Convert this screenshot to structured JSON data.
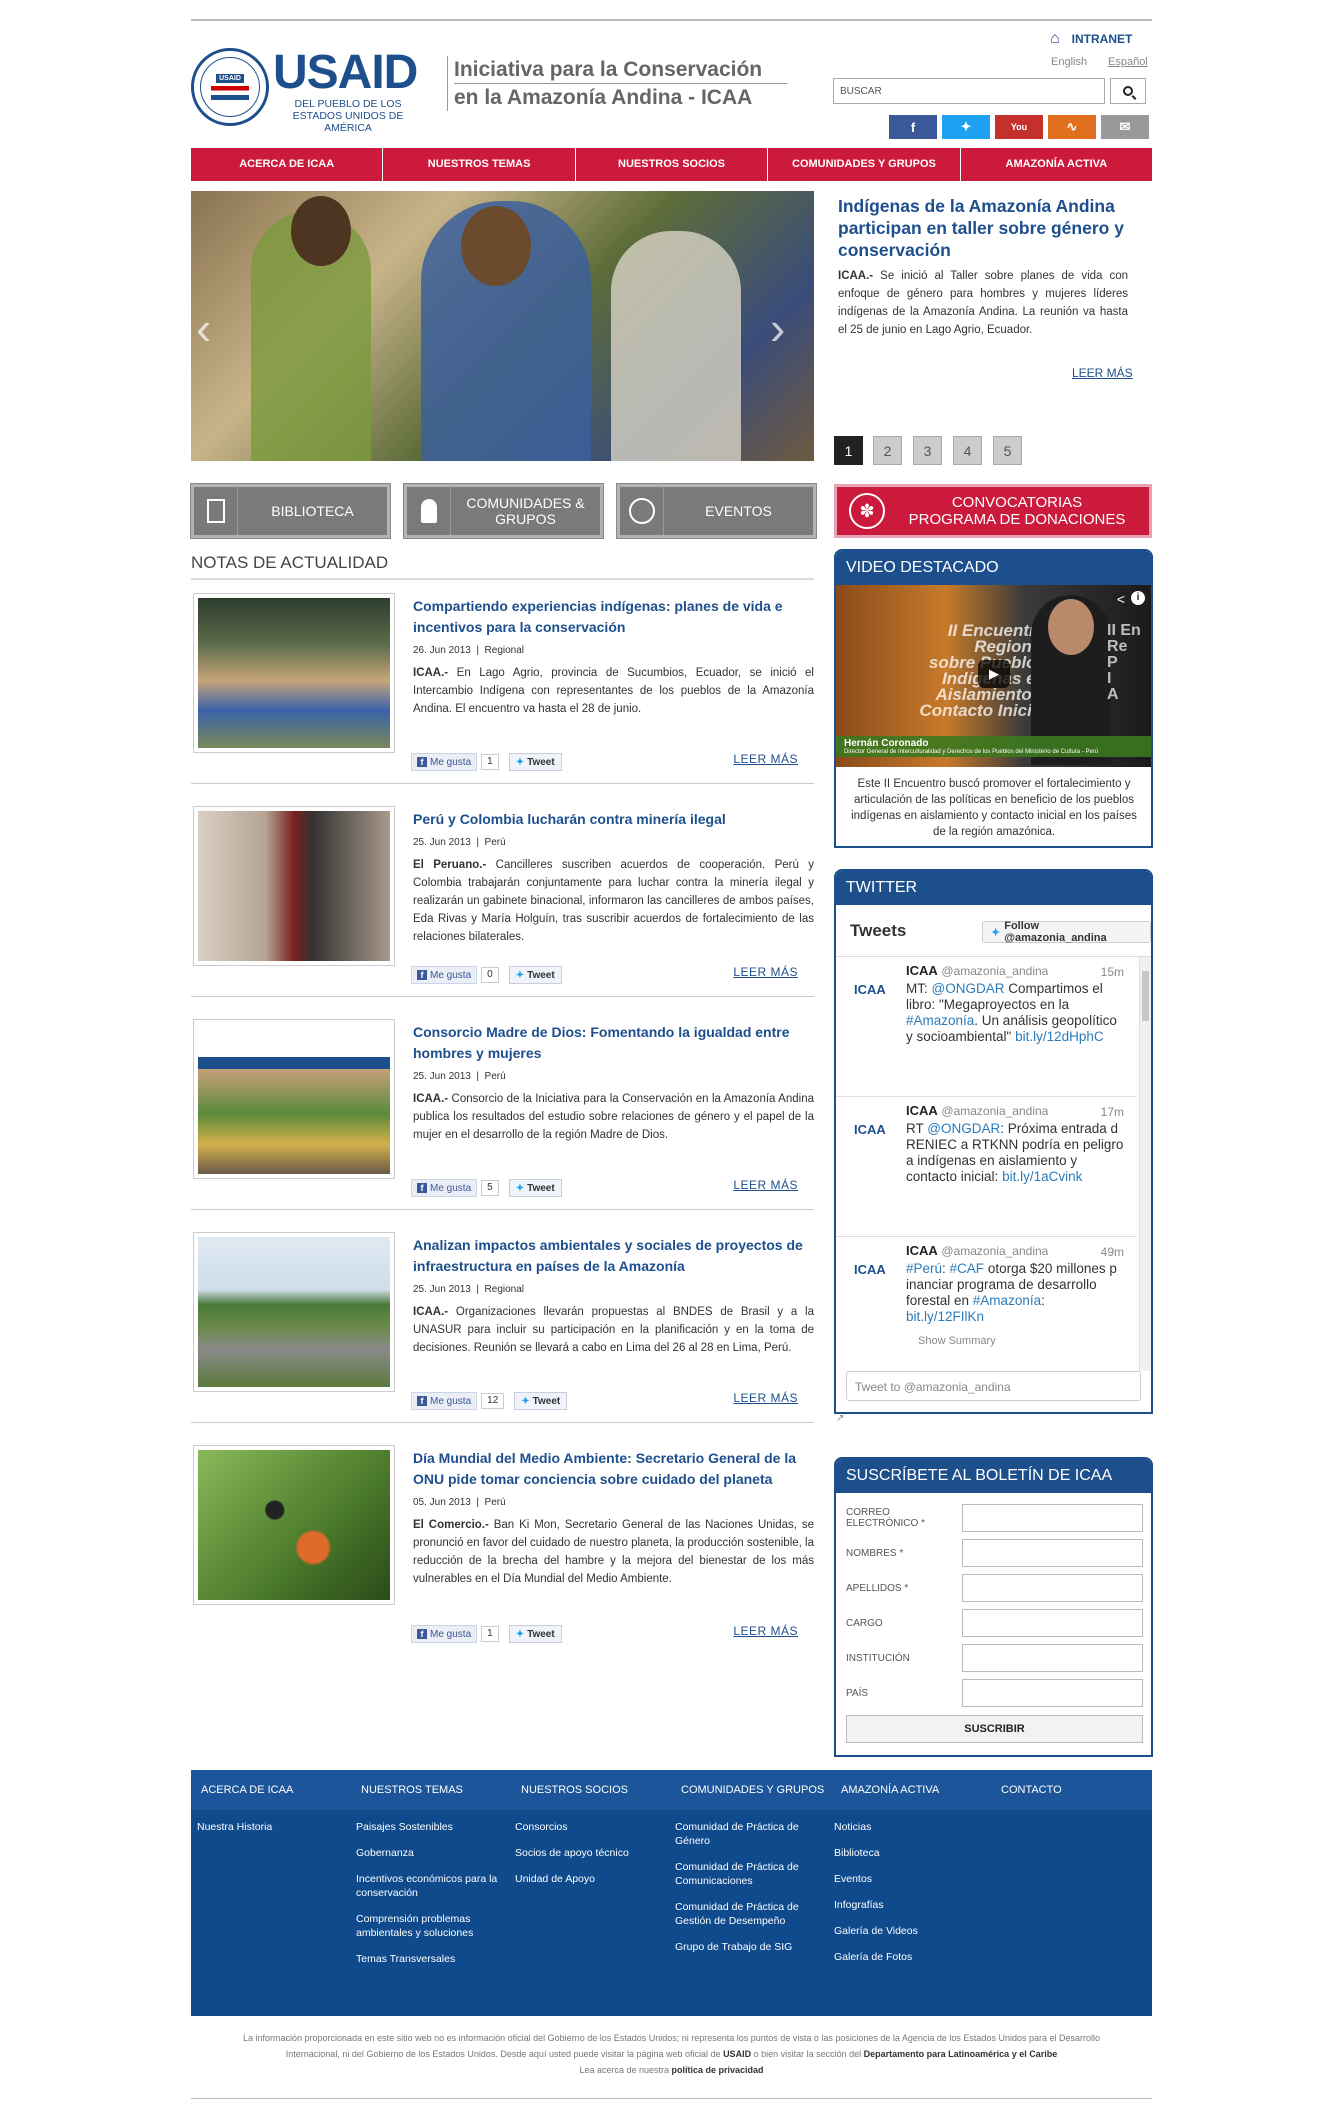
{
  "header": {
    "usaid_logo_text": "USAID",
    "usaid_sub": "DEL PUEBLO DE LOS ESTADOS UNIDOS DE AMÉRICA",
    "seal_text": "UNITED STATES AGENCY INTERNATIONAL DEVELOPMENT",
    "title_line1": "Iniciativa para la Conservación",
    "title_line2": "en la Amazonía Andina - ICAA",
    "intranet": "INTRANET",
    "lang_en": "English",
    "lang_es": "Español",
    "search_placeholder": "BUSCAR"
  },
  "nav": [
    "ACERCA DE ICAA",
    "NUESTROS TEMAS",
    "NUESTROS SOCIOS",
    "COMUNIDADES Y GRUPOS",
    "AMAZONÍA ACTIVA"
  ],
  "slider": {
    "title": "Indígenas de la Amazonía Andina participan en taller sobre género y conservación",
    "source": "ICAA.-",
    "text": " Se inició al Taller sobre planes de vida con enfoque de género para hombres y mujeres líderes indígenas de la Amazonía Andina. La reunión va hasta el 25 de junio en Lago Agrio, Ecuador.",
    "more": "LEER MÁS",
    "pages": [
      "1",
      "2",
      "3",
      "4",
      "5"
    ]
  },
  "quick_buttons": {
    "biblioteca": "BIBLIOTECA",
    "comunidades_line1": "COMUNIDADES &",
    "comunidades_line2": "GRUPOS",
    "eventos": "EVENTOS",
    "convocatorias_line1": "CONVOCATORIAS",
    "convocatorias_line2": "PROGRAMA DE DONACIONES"
  },
  "news_heading": "NOTAS DE ACTUALIDAD",
  "news": [
    {
      "title": "Compartiendo experiencias indígenas: planes de vida e incentivos para la conservación",
      "date": "26. Jun 2013",
      "region": "Regional",
      "source": "ICAA.-",
      "text": " En Lago Agrio, provincia de Sucumbios, Ecuador, se inició el Intercambio Indígena con representantes de los pueblos de la Amazonía Andina. El encuentro va hasta el 28 de junio.",
      "likes": "1",
      "like_label": "Me gusta",
      "tweet_label": "Tweet",
      "more": "LEER MÁS"
    },
    {
      "title": "Perú y Colombia lucharán contra minería ilegal",
      "date": "25. Jun 2013",
      "region": "Perú",
      "source": "El Peruano.-",
      "text": " Cancilleres suscriben acuerdos de cooperación. Perú y Colombia trabajarán conjuntamente para luchar contra la minería ilegal y realizarán un gabinete binacional, informaron las cancilleres de ambos países, Eda Rivas y María Holguín, tras suscribir acuerdos de fortalecimiento de las relaciones bilaterales.",
      "likes": "0",
      "like_label": "Me gusta",
      "tweet_label": "Tweet",
      "more": "LEER MÁS"
    },
    {
      "title": "Consorcio Madre de Dios: Fomentando la igualdad entre hombres y mujeres",
      "date": "25. Jun 2013",
      "region": "Perú",
      "source": "ICAA.-",
      "text": " Consorcio de la Iniciativa para la Conservación en la Amazonía Andina publica los resultados del estudio sobre relaciones de género y el papel de la mujer en el desarrollo de la región Madre de Dios.",
      "likes": "5",
      "like_label": "Me gusta",
      "tweet_label": "Tweet",
      "more": "LEER MÁS"
    },
    {
      "title": "Analizan impactos ambientales y sociales de proyectos de infraestructura en países de la Amazonía",
      "date": "25. Jun 2013",
      "region": "Regional",
      "source": "ICAA.-",
      "text": " Organizaciones llevarán propuestas al BNDES de Brasil y a la UNASUR para incluir su participación en la planificación y en la toma de decisiones. Reunión se llevará a cabo en Lima del 26 al 28 en Lima, Perú.",
      "likes": "12",
      "like_label": "Me gusta",
      "tweet_label": "Tweet",
      "more": "LEER MÁS"
    },
    {
      "title": "Día Mundial del Medio Ambiente: Secretario General de la ONU pide tomar conciencia sobre cuidado del planeta",
      "date": "05. Jun 2013",
      "region": "Perú",
      "source": "El Comercio.-",
      "text": " Ban Ki Mon, Secretario General de las Naciones Unidas, se pronunció en favor del cuidado de nuestro planeta, la producción sostenible, la reducción de la brecha del hambre y la mejora del bienestar de los más vulnerables en el Día Mundial del Medio Ambiente.",
      "likes": "1",
      "like_label": "Me gusta",
      "tweet_label": "Tweet",
      "more": "LEER MÁS"
    }
  ],
  "video": {
    "heading": "VIDEO DESTACADO",
    "overlay_lines": [
      "II Encuentro",
      "Regional",
      "sobre Pueblos",
      "Indígenas en",
      "Aislamiento y",
      "Contacto Inicial"
    ],
    "caption_name": "Hernán Coronado",
    "caption_role": "Director General de Interculturalidad y Derechos de los Pueblos del Ministerio de Cultura - Perú",
    "desc": "Este II Encuentro buscó promover el fortalecimiento y articulación de las políticas en beneficio de los pueblos indígenas en aislamiento y contacto inicial en los países de la región amazónica."
  },
  "twitter": {
    "heading": "TWITTER",
    "tweets_label": "Tweets",
    "follow": "Follow @amazonia_andina",
    "items": [
      {
        "logo": "ICAA",
        "name": "ICAA",
        "handle": "@amazonia_andina",
        "time": "15m",
        "pre": "MT: ",
        "l1": "@ONGDAR",
        "mid": " Compartimos el libro: \"Megaproyectos en la ",
        "l2": "#Amazonía",
        "post": ". Un análisis geopolítico y socioambiental\" ",
        "l3": "bit.ly/12dHphC"
      },
      {
        "logo": "ICAA",
        "name": "ICAA",
        "handle": "@amazonia_andina",
        "time": "17m",
        "pre": "RT ",
        "l1": "@ONGDAR",
        "mid": ": Próxima entrada d RENIEC a RTKNN podría en peligro a indígenas en aislamiento y contacto inicial: ",
        "l2": "",
        "post": "",
        "l3": "bit.ly/1aCvink"
      },
      {
        "logo": "ICAA",
        "name": "ICAA",
        "handle": "@amazonia_andina",
        "time": "49m",
        "pre": "",
        "l1": "#Perú",
        "mid": ": ",
        "l2": "#CAF",
        "post": " otorga $20 millones p inanciar programa de desarrollo forestal en ",
        "l3": "#Amazonía",
        "l4": "bit.ly/12FIlKn",
        "summary": "Show Summary"
      }
    ],
    "input_placeholder": "Tweet to @amazonia_andina"
  },
  "newsletter": {
    "heading": "SUSCRÍBETE AL BOLETÍN DE ICAA",
    "fields": [
      "CORREO ELECTRÓNICO *",
      "NOMBRES *",
      "APELLIDOS *",
      "CARGO",
      "INSTITUCIÓN",
      "PAÍS"
    ],
    "submit": "SUSCRIBIR"
  },
  "footer": {
    "headings": [
      "ACERCA DE ICAA",
      "NUESTROS TEMAS",
      "NUESTROS SOCIOS",
      "COMUNIDADES Y GRUPOS",
      "AMAZONÍA ACTIVA",
      "CONTACTO"
    ],
    "col1": [
      "Nuestra Historia"
    ],
    "col2": [
      "Paisajes Sostenibles",
      "Gobernanza",
      "Incentivos económicos para la conservación",
      "Comprensión problemas ambientales y soluciones",
      "Temas Transversales"
    ],
    "col3": [
      "Consorcios",
      "Socios de apoyo técnico",
      "Unidad de Apoyo"
    ],
    "col4": [
      "Comunidad de Práctica de Género",
      "Comunidad de Práctica de Comunicaciones",
      "Comunidad de Práctica de Gestión de Desempeño",
      "Grupo de Trabajo de SIG"
    ],
    "col5": [
      "Noticias",
      "Biblioteca",
      "Eventos",
      "Infografías",
      "Galería de Videos",
      "Galería de Fotos"
    ]
  },
  "disclaimer": {
    "line1": "La información proporcionada en este sitio web no es información oficial del Gobierno de los Estados Unidos; ni representa los puntos de vista o las posiciones de la Agencia de los Estados Unidos para el Desarrollo",
    "line2a": "Internacional, ni del Gobierno de los Estados Unidos. Desde aquí usted puede visitar la página web oficial de ",
    "usaid": "USAID",
    "line2b": " o bien visitar la sección del ",
    "dept": "Departamento para Latinoamérica y el Caribe",
    "line3a": "Lea acerca de nuestra ",
    "privacy": "política de privacidad"
  }
}
